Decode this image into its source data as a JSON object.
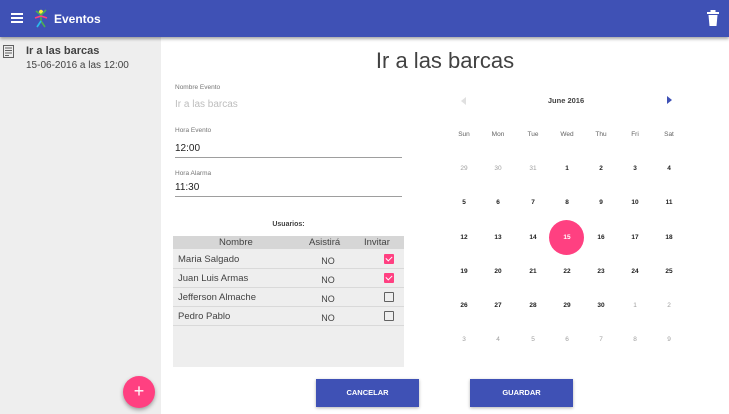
{
  "app": {
    "title": "Eventos"
  },
  "sidebar": {
    "items": [
      {
        "title": "Ir a las barcas",
        "subtitle": "15-06-2016 a las 12:00"
      }
    ],
    "fab_label": "+"
  },
  "main": {
    "title": "Ir a las barcas",
    "nombre_label": "Nombre Evento",
    "nombre_placeholder": "Ir a las barcas",
    "hora_label": "Hora Evento",
    "hora_value": "12:00",
    "alarma_label": "Hora Alarma",
    "alarma_value": "11:30",
    "usuarios_label": "Usuarios:"
  },
  "table": {
    "headers": {
      "nombre": "Nombre",
      "asistira": "Asistirá",
      "invitar": "Invitar"
    },
    "rows": [
      {
        "nombre": "Maria Salgado",
        "asistira": "NO",
        "invitar": true
      },
      {
        "nombre": "Juan Luis Armas",
        "asistira": "NO",
        "invitar": true
      },
      {
        "nombre": "Jefferson Almache",
        "asistira": "NO",
        "invitar": false
      },
      {
        "nombre": "Pedro Pablo",
        "asistira": "NO",
        "invitar": false
      }
    ]
  },
  "calendar": {
    "month_label": "June 2016",
    "weekdays": [
      "Sun",
      "Mon",
      "Tue",
      "Wed",
      "Thu",
      "Fri",
      "Sat"
    ],
    "weeks": [
      [
        "29",
        "30",
        "31",
        "1",
        "2",
        "3",
        "4"
      ],
      [
        "5",
        "6",
        "7",
        "8",
        "9",
        "10",
        "11"
      ],
      [
        "12",
        "13",
        "14",
        "15",
        "16",
        "17",
        "18"
      ],
      [
        "19",
        "20",
        "21",
        "22",
        "23",
        "24",
        "25"
      ],
      [
        "26",
        "27",
        "28",
        "29",
        "30",
        "1",
        "2"
      ],
      [
        "3",
        "4",
        "5",
        "6",
        "7",
        "8",
        "9"
      ]
    ],
    "selected": "15"
  },
  "buttons": {
    "cancel": "CANCELAR",
    "save": "GUARDAR"
  },
  "colors": {
    "primary": "#3f51b5",
    "accent": "#ff4081"
  }
}
